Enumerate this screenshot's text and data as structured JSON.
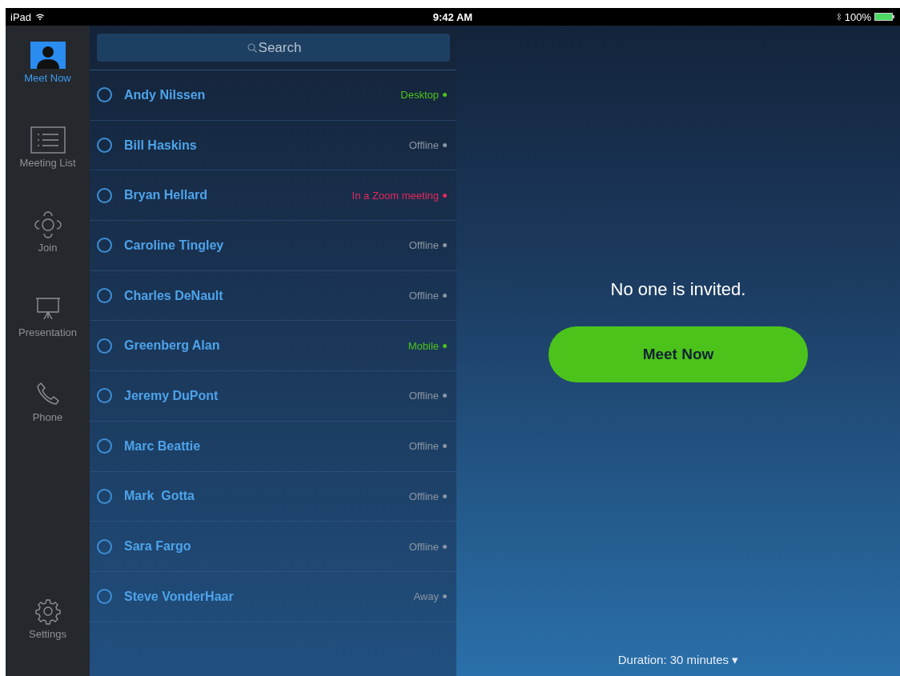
{
  "status_bar": {
    "device": "iPad",
    "time": "9:42 AM",
    "battery_text": "100%"
  },
  "sidebar": {
    "items": [
      {
        "kind": "person",
        "label": "Meet Now",
        "selected": true
      },
      {
        "kind": "list",
        "label": "Meeting List",
        "selected": false
      },
      {
        "kind": "join",
        "label": "Join",
        "selected": false
      },
      {
        "kind": "presentation",
        "label": "Presentation",
        "selected": false
      },
      {
        "kind": "phone",
        "label": "Phone",
        "selected": false
      }
    ],
    "footer_item": {
      "kind": "settings",
      "label": "Settings",
      "selected": false
    }
  },
  "search": {
    "placeholder": "Search"
  },
  "contacts": [
    {
      "name": "Andy Nilssen",
      "status": "Desktop",
      "color": "#4cc31a",
      "checked": false
    },
    {
      "name": "Bill Haskins",
      "status": "Offline",
      "color": "#8a96a3",
      "checked": false
    },
    {
      "name": "Bryan Hellard",
      "status": "In a Zoom meeting",
      "color": "#e8265e",
      "checked": false
    },
    {
      "name": "Caroline Tingley",
      "status": "Offline",
      "color": "#8a96a3",
      "checked": false
    },
    {
      "name": "Charles DeNault",
      "status": "Offline",
      "color": "#8a96a3",
      "checked": false
    },
    {
      "name": "Greenberg Alan",
      "status": "Mobile",
      "color": "#4cc31a",
      "checked": false
    },
    {
      "name": "Jeremy DuPont",
      "status": "Offline",
      "color": "#8a96a3",
      "checked": false
    },
    {
      "name": "Marc Beattie",
      "status": "Offline",
      "color": "#8a96a3",
      "checked": false
    },
    {
      "name": "Mark  Gotta",
      "status": "Offline",
      "color": "#8a96a3",
      "checked": false
    },
    {
      "name": "Sara Fargo",
      "status": "Offline",
      "color": "#8a96a3",
      "checked": false
    },
    {
      "name": "Steve VonderHaar",
      "status": "Away",
      "color": "#8a96a3",
      "checked": false
    }
  ],
  "main": {
    "message": "No one is invited.",
    "button": "Meet Now",
    "duration": "Duration: 30 minutes ▾"
  }
}
